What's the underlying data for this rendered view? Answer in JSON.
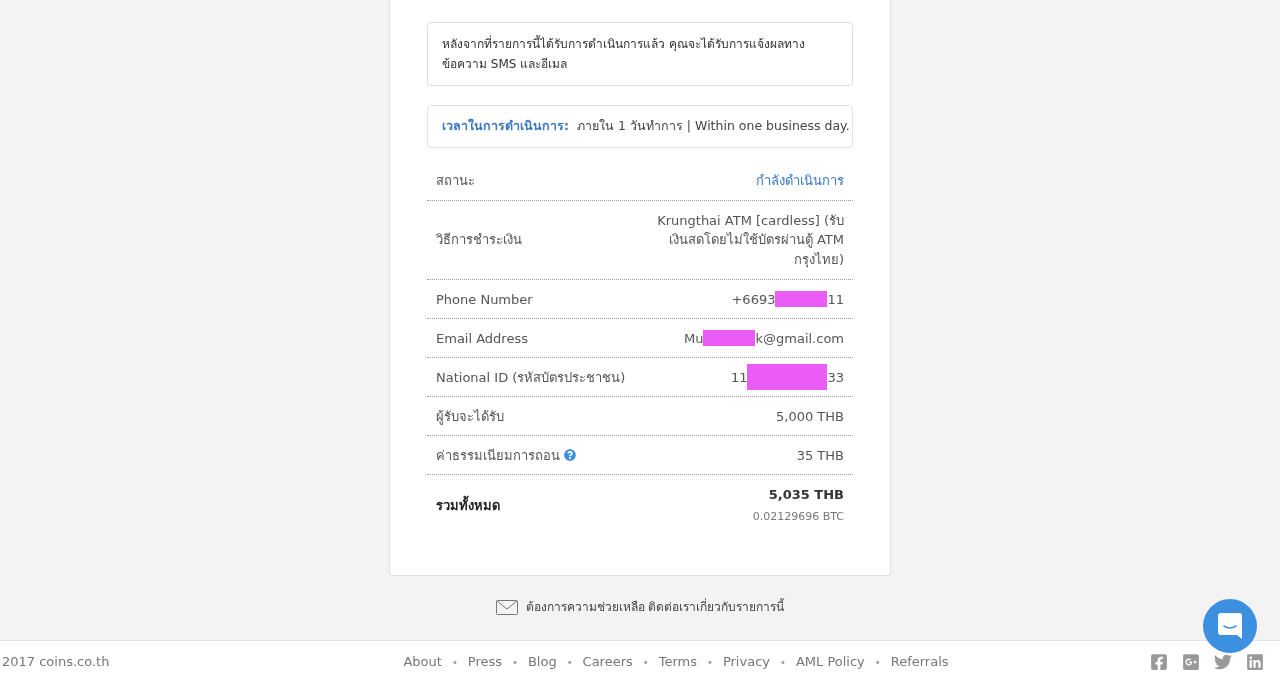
{
  "notice": "หลังจากที่รายการนี้ได้รับการดำเนินการแล้ว คุณจะได้รับการแจ้งผลทาง ข้อความ SMS และอีเมล",
  "processing_time": {
    "label": "เวลาในการดำเนินการ:",
    "value": "ภายใน 1 วันทำการ | Within one business day."
  },
  "details": [
    {
      "kind": "status",
      "label": "สถานะ",
      "value": "กำลังดำเนินการ"
    },
    {
      "kind": "plain",
      "label": "วิธีการชำระเงิน",
      "value": "Krungthai ATM [cardless] (รับเงินสดโดยไม่ใช้บัตรผ่านตู้ ATM กรุงไทย)"
    },
    {
      "kind": "redacted",
      "label": "Phone Number",
      "value_start": "+6693",
      "value_end": "11"
    },
    {
      "kind": "redacted",
      "label": "Email Address",
      "value_start": "Mu",
      "value_end": "k@gmail.com"
    },
    {
      "kind": "redacted",
      "label": "National ID (รหัสบัตรประชาชน)",
      "value_start": "11",
      "value_end": "33"
    },
    {
      "kind": "plain",
      "label": "ผู้รับจะได้รับ",
      "value": "5,000 THB"
    },
    {
      "kind": "help",
      "label": "ค่าธรรมเนียมการถอน",
      "value": "35 THB"
    },
    {
      "kind": "total",
      "label": "รวมทั้งหมด",
      "value": "5,035 THB",
      "subvalue": "0.02129696 BTC"
    }
  ],
  "help_link": "ต้องการความช่วยเหลือ ติดต่อเราเกี่ยวกับรายการนี้",
  "footer": {
    "copyright": "2017 coins.co.th",
    "links": [
      "About",
      "Press",
      "Blog",
      "Careers",
      "Terms",
      "Privacy",
      "AML Policy",
      "Referrals"
    ],
    "separator": "•"
  }
}
